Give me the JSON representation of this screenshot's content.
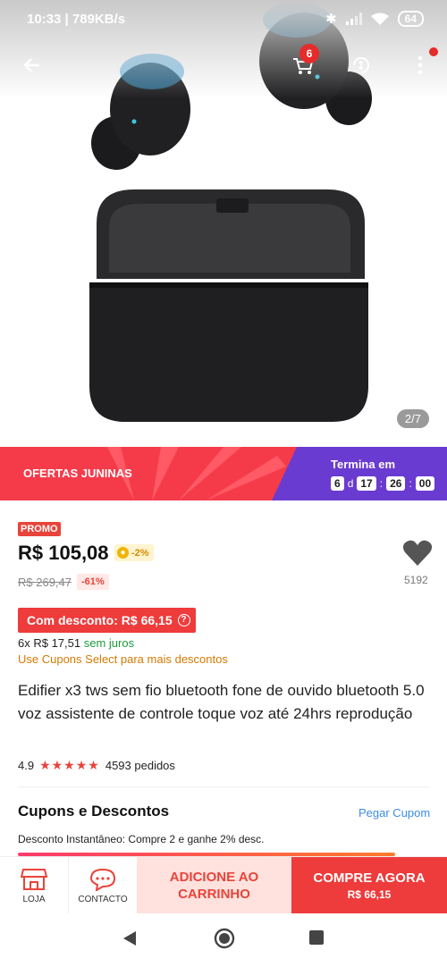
{
  "status_bar": {
    "time_speed": "10:33 | 789KB/s",
    "battery": "64"
  },
  "header": {
    "cart_count": "6"
  },
  "gallery": {
    "counter": "2/7"
  },
  "promo_band": {
    "label": "OFERTAS JUNINAS",
    "ends_label": "Termina em",
    "days": "6",
    "day_unit": "d",
    "hours": "17",
    "minutes": "26",
    "seconds": "00"
  },
  "price": {
    "promo_tag": "PROMO",
    "current": "R$ 105,08",
    "coin_pct": "-2%",
    "original": "R$ 269,47",
    "discount": "-61%",
    "with_discount": "Com desconto: R$ 66,15",
    "installments_prefix": "6x R$ 17,51",
    "installments_suffix": "sem juros",
    "coupons_hint": "Use Cupons Select para mais descontos"
  },
  "favorites": {
    "count": "5192"
  },
  "product": {
    "title": "Edifier x3 tws sem fio bluetooth fone de ouvido bluetooth 5.0 voz assistente de controle toque voz até 24hrs reprodução",
    "rating": "4.9",
    "stars": "★★★★★",
    "orders": "4593 pedidos"
  },
  "coupons": {
    "title": "Cupons e Descontos",
    "action": "Pegar Cupom",
    "line": "Desconto Instantâneo: Compre 2 e ganhe 2% desc."
  },
  "action_bar": {
    "store": "LOJA",
    "contact": "CONTACTO",
    "add_cart": "ADICIONE AO CARRINHO",
    "buy_now": "COMPRE AGORA",
    "buy_price": "R$ 66,15"
  }
}
